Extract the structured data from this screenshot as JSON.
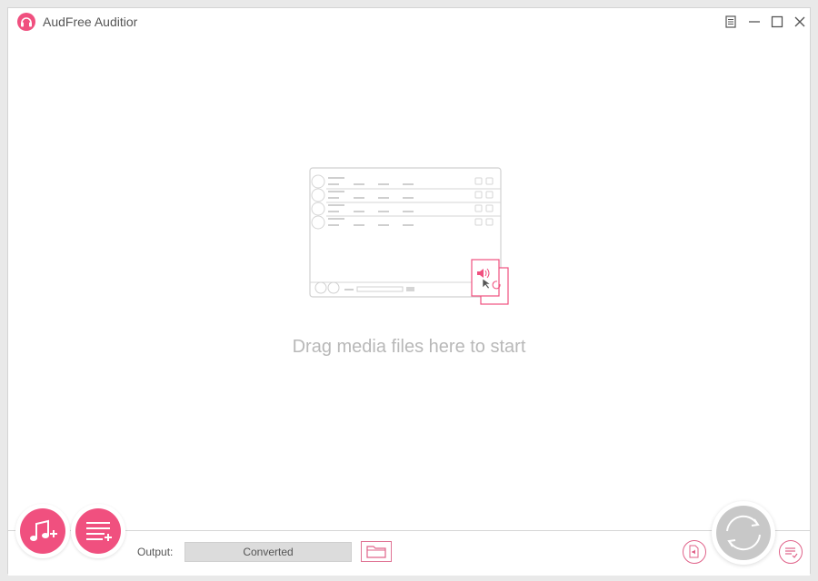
{
  "window": {
    "title": "AudFree Auditior"
  },
  "titlebar_buttons": [
    {
      "name": "menu-icon"
    },
    {
      "name": "minimize-icon"
    },
    {
      "name": "maximize-icon"
    },
    {
      "name": "close-icon"
    }
  ],
  "drop_area": {
    "hint": "Drag media files here to start"
  },
  "bottom": {
    "output_label": "Output:",
    "output_value": "Converted"
  },
  "colors": {
    "accent": "#f0507f",
    "accent_border": "#e0638a",
    "hint_text": "#b8b8b8",
    "field_bg": "#dcdcdc",
    "convert_disabled": "#c8c8c8"
  }
}
